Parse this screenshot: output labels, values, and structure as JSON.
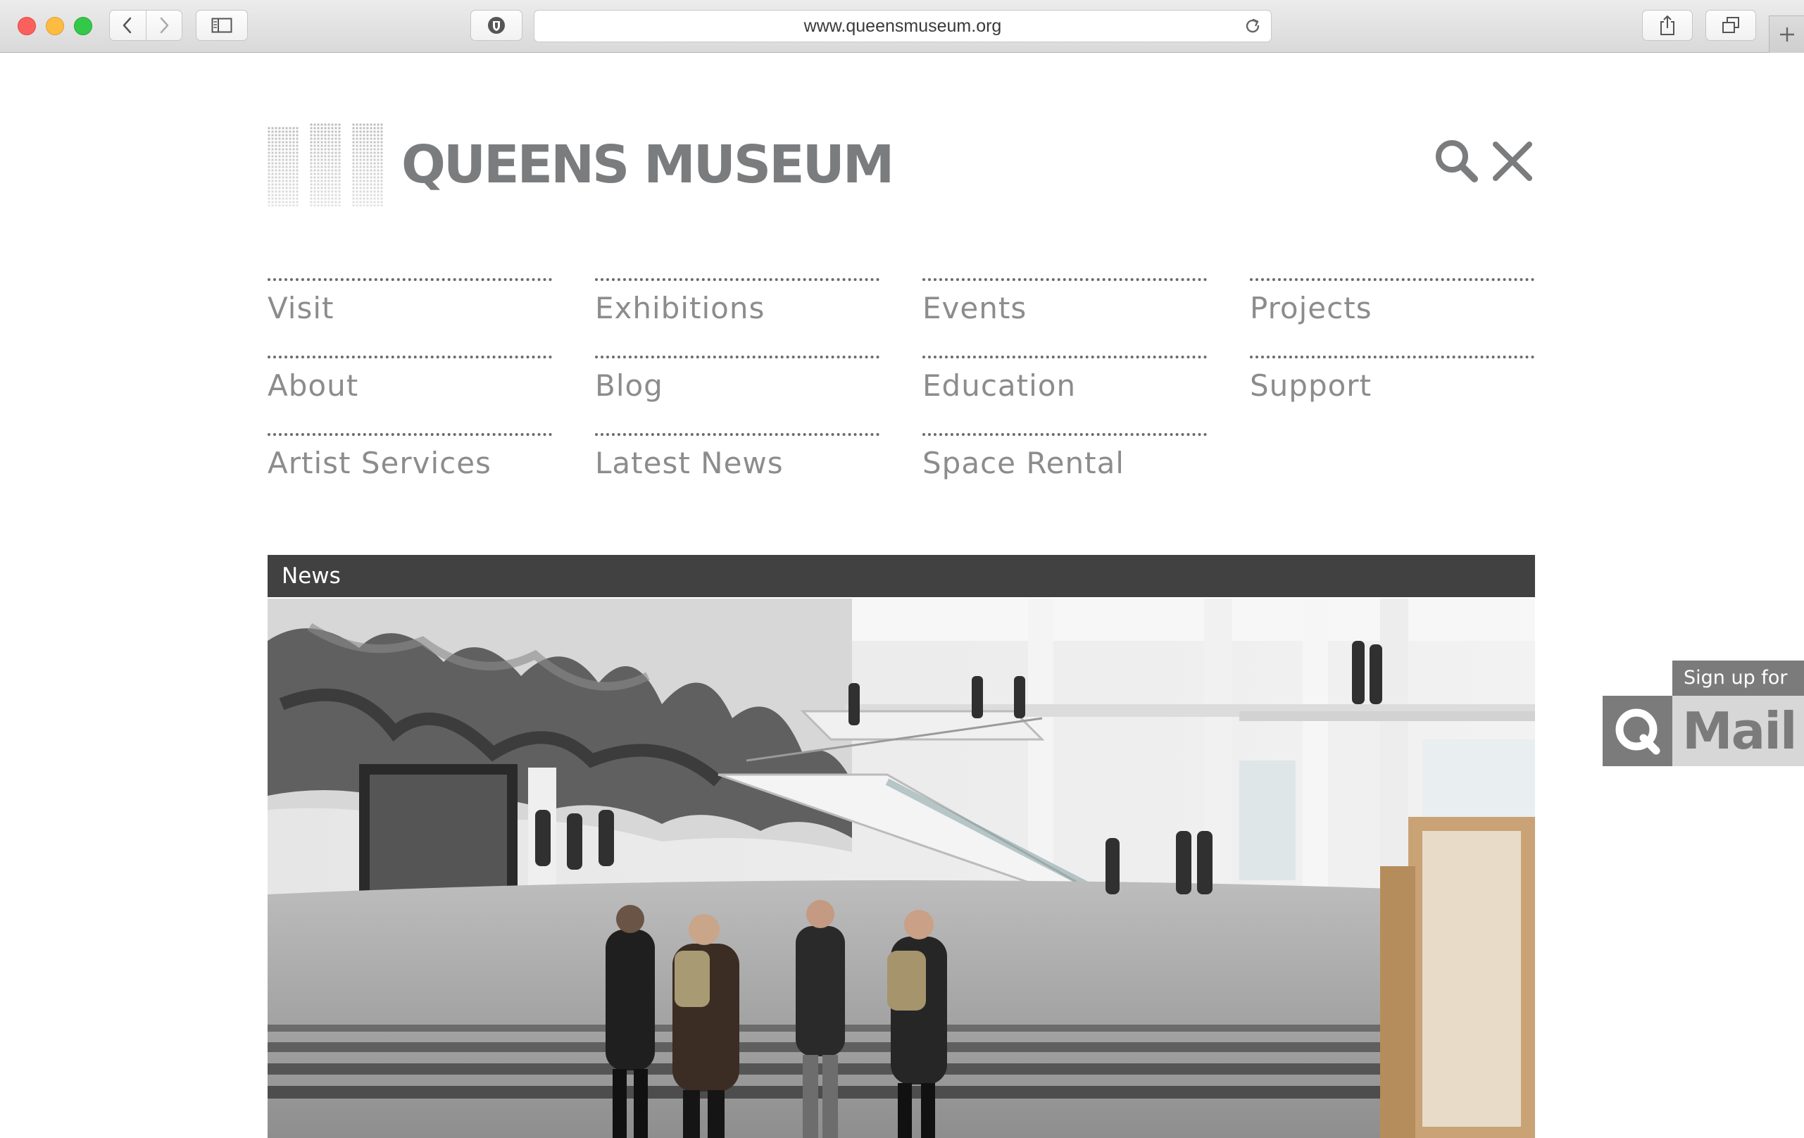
{
  "browser": {
    "url": "www.queensmuseum.org"
  },
  "site": {
    "name": "QUEENS MUSEUM"
  },
  "menu": {
    "items": [
      {
        "label": "Visit"
      },
      {
        "label": "Exhibitions"
      },
      {
        "label": "Events"
      },
      {
        "label": "Projects"
      },
      {
        "label": "About"
      },
      {
        "label": "Blog"
      },
      {
        "label": "Education"
      },
      {
        "label": "Support"
      },
      {
        "label": "Artist Services"
      },
      {
        "label": "Latest News"
      },
      {
        "label": "Space Rental"
      }
    ]
  },
  "news": {
    "section_label": "News"
  },
  "qmail": {
    "signup_text": "Sign up for",
    "letter": "Q",
    "brand": "Mail"
  },
  "icons": {
    "search": "search-icon",
    "close": "close-icon"
  },
  "colors": {
    "logo_gray": "#7b7c7e",
    "menu_text": "#8c8c8c",
    "news_bar": "#414141"
  }
}
